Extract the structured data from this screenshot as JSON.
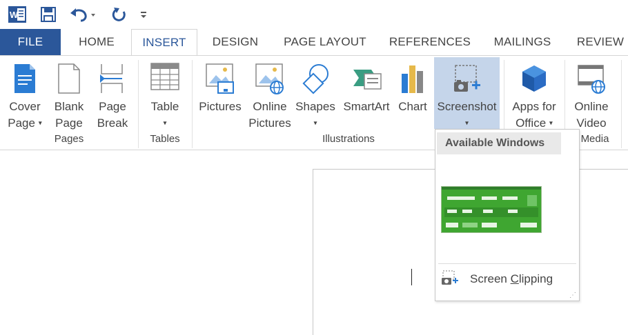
{
  "qat": {
    "word_icon": "word-logo-icon",
    "save_icon": "save-icon",
    "undo_icon": "undo-icon",
    "redo_icon": "redo-icon",
    "customize_icon": "customize-qat-icon"
  },
  "tabs": [
    {
      "label": "FILE"
    },
    {
      "label": "HOME"
    },
    {
      "label": "INSERT"
    },
    {
      "label": "DESIGN"
    },
    {
      "label": "PAGE LAYOUT"
    },
    {
      "label": "REFERENCES"
    },
    {
      "label": "MAILINGS"
    },
    {
      "label": "REVIEW"
    }
  ],
  "ribbon": {
    "cover_page": {
      "line1": "Cover",
      "line2": "Page"
    },
    "blank_page": {
      "line1": "Blank",
      "line2": "Page"
    },
    "page_break": {
      "line1": "Page",
      "line2": "Break"
    },
    "table": {
      "line1": "Table"
    },
    "pictures": {
      "line1": "Pictures"
    },
    "online_pictures": {
      "line1": "Online",
      "line2": "Pictures"
    },
    "shapes": {
      "line1": "Shapes"
    },
    "smartart": {
      "line1": "SmartArt"
    },
    "chart": {
      "line1": "Chart"
    },
    "screenshot": {
      "line1": "Screenshot"
    },
    "apps_for_office": {
      "line1": "Apps for",
      "line2": "Office"
    },
    "online_video": {
      "line1": "Online",
      "line2": "Video"
    },
    "groups": {
      "pages": "Pages",
      "tables": "Tables",
      "illustrations": "Illustrations",
      "media": "Media"
    }
  },
  "dropdown": {
    "header": "Available Windows",
    "clipping_prefix": "Screen ",
    "clipping_accel": "C",
    "clipping_suffix": "lipping"
  },
  "colors": {
    "file_tab": "#2b579a",
    "active_tab_text": "#2b579a",
    "highlight": "#c5d5ea",
    "icon_blue": "#2b7cd3",
    "icon_gray": "#9a9a9a"
  }
}
